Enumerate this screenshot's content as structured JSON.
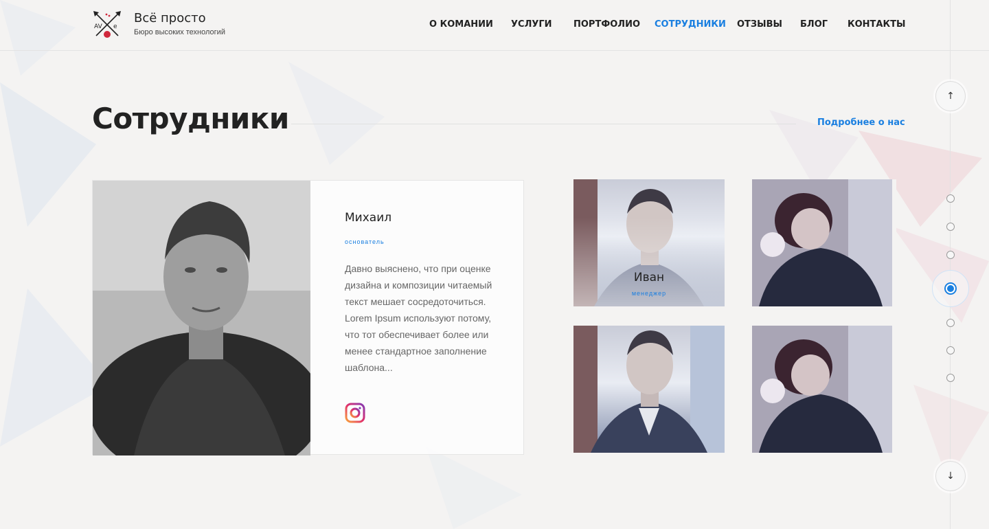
{
  "brand": {
    "title": "Всё просто",
    "subtitle": "Бюро высоких технологий"
  },
  "nav": {
    "items": [
      {
        "label": "О КОМАНИИ",
        "active": false
      },
      {
        "label": "УСЛУГИ",
        "active": false
      },
      {
        "label": "ПОРТФОЛИО",
        "active": false
      },
      {
        "label": "СОТРУДНИКИ",
        "active": true
      },
      {
        "label": "ОТЗЫВЫ",
        "active": false
      },
      {
        "label": "БЛОГ",
        "active": false
      },
      {
        "label": "КОНТАКТЫ",
        "active": false
      }
    ]
  },
  "section": {
    "title": "Сотрудники",
    "more_link": "Подробнее о нас"
  },
  "featured": {
    "name": "Михаил",
    "role": "основатель",
    "description": "Давно выяснено, что при оценке дизайна и композиции читаемый текст мешает сосредоточиться. Lorem Ipsum используют потому, что тот обеспечивает более или менее стандартное заполнение шаблона...",
    "social_icon": "instagram-icon"
  },
  "team": [
    {
      "name": "Иван",
      "role": "менеджер",
      "photo": "man"
    },
    {
      "name": "",
      "role": "",
      "photo": "woman"
    },
    {
      "name": "",
      "role": "",
      "photo": "man"
    },
    {
      "name": "",
      "role": "",
      "photo": "woman"
    }
  ],
  "side_nav": {
    "up_icon": "arrow-up-icon",
    "down_icon": "arrow-down-icon",
    "dots": 7,
    "active_dot": 4
  },
  "colors": {
    "accent": "#1a7fe0",
    "text": "#222222",
    "muted": "#666666"
  }
}
